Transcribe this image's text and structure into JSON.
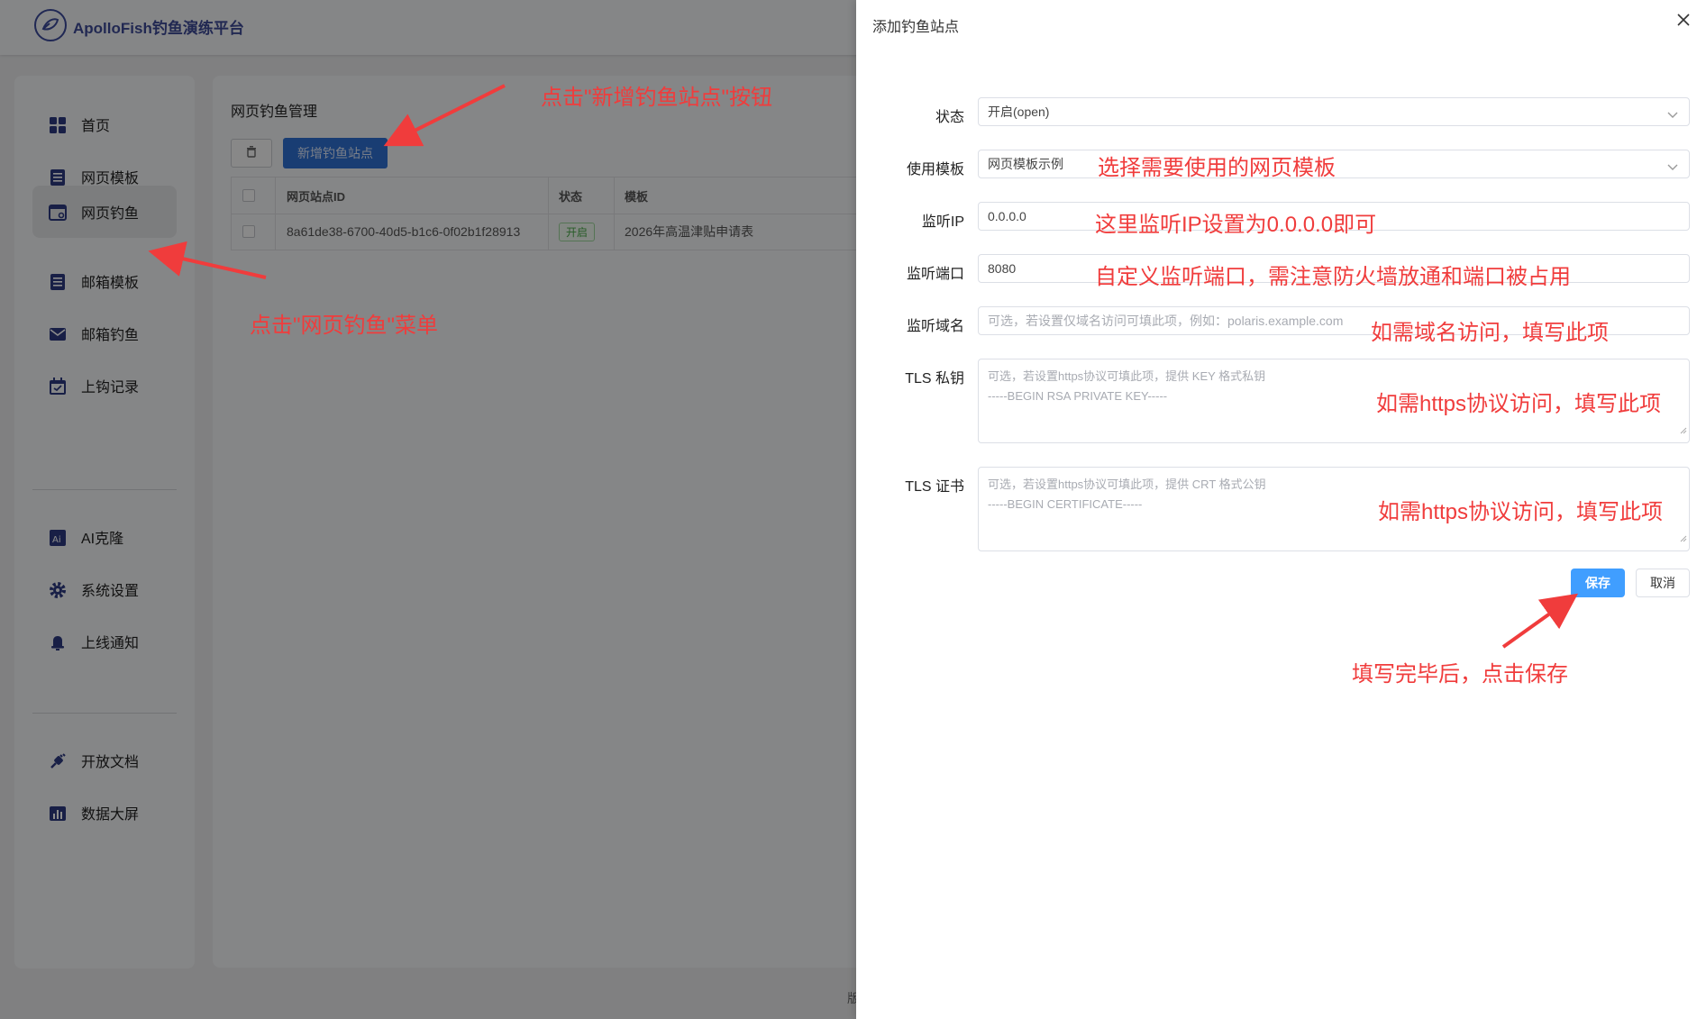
{
  "app": {
    "brand": "ApolloFish钓鱼演练平台",
    "accent_color": "#2f6fd1",
    "annotation_color": "#f03c3c"
  },
  "sidebar": {
    "items": [
      {
        "label": "首页",
        "icon": "dashboard-grid-icon",
        "active": false
      },
      {
        "label": "网页模板",
        "icon": "document-icon",
        "active": false
      },
      {
        "label": "网页钓鱼",
        "icon": "browser-window-icon",
        "active": true
      },
      {
        "label": "邮箱模板",
        "icon": "document-icon",
        "active": false
      },
      {
        "label": "邮箱钓鱼",
        "icon": "mail-icon",
        "active": false
      },
      {
        "label": "上钩记录",
        "icon": "calendar-icon",
        "active": false
      },
      {
        "label": "AI克隆",
        "icon": "ai-icon",
        "active": false
      },
      {
        "label": "系统设置",
        "icon": "gear-icon",
        "active": false
      },
      {
        "label": "上线通知",
        "icon": "bell-icon",
        "active": false
      },
      {
        "label": "开放文档",
        "icon": "plug-icon",
        "active": false
      },
      {
        "label": "数据大屏",
        "icon": "bar-chart-icon",
        "active": false
      }
    ]
  },
  "main": {
    "title": "网页钓鱼管理",
    "add_button": "新增钓鱼站点",
    "table": {
      "columns": [
        "网页站点ID",
        "状态",
        "模板"
      ],
      "rows": [
        {
          "id": "8a61de38-6700-40d5-b1c6-0f02b1f28913",
          "status": "开启",
          "template": "2026年高温津贴申请表"
        }
      ]
    },
    "footer_partial": "版"
  },
  "drawer": {
    "title": "添加钓鱼站点",
    "fields": {
      "status": {
        "label": "状态",
        "value": "开启(open)"
      },
      "template": {
        "label": "使用模板",
        "value": "网页模板示例"
      },
      "listen_ip": {
        "label": "监听IP",
        "value": "0.0.0.0"
      },
      "listen_port": {
        "label": "监听端口",
        "value": "8080"
      },
      "domain": {
        "label": "监听域名",
        "placeholder": "可选，若设置仅域名访问可填此项，例如：polaris.example.com"
      },
      "tls_key": {
        "label": "TLS 私钥",
        "placeholder_line1": "可选，若设置https协议可填此项，提供 KEY 格式私钥",
        "placeholder_line2": "-----BEGIN RSA PRIVATE KEY-----"
      },
      "tls_cert": {
        "label": "TLS 证书",
        "placeholder_line1": "可选，若设置https协议可填此项，提供 CRT 格式公钥",
        "placeholder_line2": "-----BEGIN CERTIFICATE-----"
      }
    },
    "save": "保存",
    "cancel": "取消"
  },
  "annotations": {
    "click_add": "点击\"新增钓鱼站点\"按钮",
    "click_menu": "点击\"网页钓鱼\"菜单",
    "choose_template": "选择需要使用的网页模板",
    "set_ip": "这里监听IP设置为0.0.0.0即可",
    "set_port": "自定义监听端口，需注意防火墙放通和端口被占用",
    "domain_hint": "如需域名访问，填写此项",
    "https_key_hint": "如需https协议访问，填写此项",
    "https_cert_hint": "如需https协议访问，填写此项",
    "save_hint": "填写完毕后，点击保存"
  }
}
